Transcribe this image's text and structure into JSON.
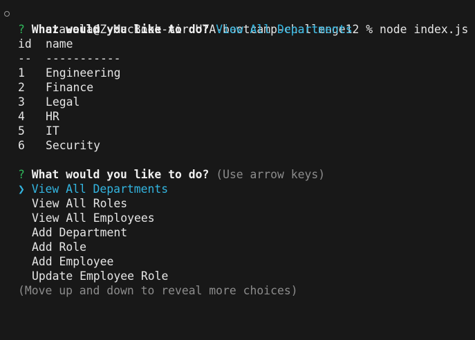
{
  "prompt_line": {
    "prompt": "czavala@Z-MacBook-Air UTA-bootcamp-challenge12 %",
    "command": "node index.js"
  },
  "question1": {
    "mark": "?",
    "text": "What would you like to do?",
    "answer": "View All Departments"
  },
  "table": {
    "headers": [
      "id",
      "name"
    ],
    "separators": [
      "--",
      "-----------"
    ],
    "rows": [
      {
        "id": "1",
        "name": "Engineering"
      },
      {
        "id": "2",
        "name": "Finance"
      },
      {
        "id": "3",
        "name": "Legal"
      },
      {
        "id": "4",
        "name": "HR"
      },
      {
        "id": "5",
        "name": "IT"
      },
      {
        "id": "6",
        "name": "Security"
      }
    ]
  },
  "question2": {
    "mark": "?",
    "text": "What would you like to do?",
    "hint": "(Use arrow keys)"
  },
  "menu": {
    "pointer": "❯",
    "selected": "View All Departments",
    "options": [
      "View All Roles",
      "View All Employees",
      "Add Department",
      "Add Role",
      "Add Employee",
      "Update Employee Role"
    ],
    "footer": "(Move up and down to reveal more choices)"
  },
  "colors": {
    "background": "#181818",
    "question_mark": "#2fb65a",
    "answer_accent": "#33b5e0",
    "hint": "#8c8c8c"
  }
}
